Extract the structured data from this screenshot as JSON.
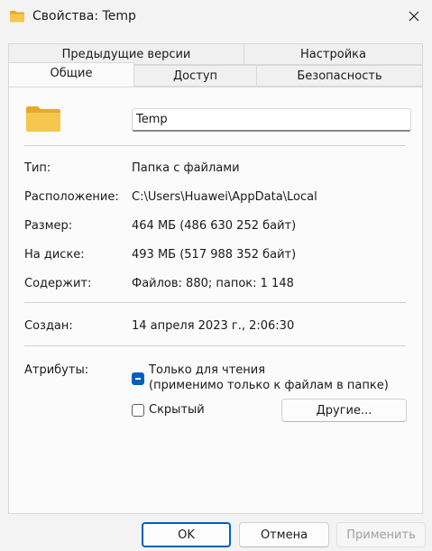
{
  "window": {
    "title": "Свойства: Temp",
    "icon": "folder-icon",
    "close_icon": "close-icon"
  },
  "tabs": {
    "row_back": [
      "Предыдущие версии",
      "Настройка"
    ],
    "row_front": [
      "Общие",
      "Доступ",
      "Безопасность"
    ],
    "active": "Общие"
  },
  "general": {
    "name_value": "Temp",
    "rows": [
      {
        "label": "Тип:",
        "value": "Папка с файлами"
      },
      {
        "label": "Расположение:",
        "value": "C:\\Users\\Huawei\\AppData\\Local"
      },
      {
        "label": "Размер:",
        "value": "464 МБ (486 630 252 байт)"
      },
      {
        "label": "На диске:",
        "value": "493 МБ (517 988 352 байт)"
      },
      {
        "label": "Содержит:",
        "value": "Файлов: 880; папок: 1 148"
      }
    ],
    "created": {
      "label": "Создан:",
      "value": "14 апреля 2023 г., 2:06:30"
    },
    "attributes": {
      "label": "Атрибуты:",
      "readonly_line1": "Только для чтения",
      "readonly_line2": "(применимо только к файлам в папке)",
      "readonly_state": "indeterminate",
      "hidden_label": "Скрытый",
      "hidden_checked": false,
      "other_button": "Другие..."
    }
  },
  "footer": {
    "ok": "OK",
    "cancel": "Отмена",
    "apply": "Применить"
  },
  "colors": {
    "accent": "#005fb8",
    "folder": "#f3c04b"
  }
}
